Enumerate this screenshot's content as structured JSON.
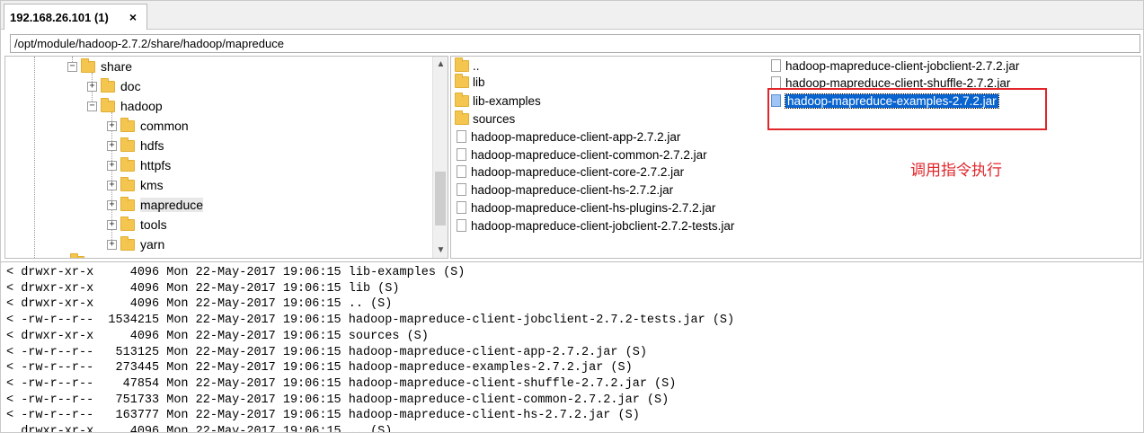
{
  "tab": {
    "title": "192.168.26.101 (1)",
    "close": "×"
  },
  "path": "/opt/module/hadoop-2.7.2/share/hadoop/mapreduce",
  "tree": [
    {
      "label": "share",
      "expander": "−"
    },
    {
      "label": "doc",
      "expander": "+"
    },
    {
      "label": "hadoop",
      "expander": "−"
    },
    {
      "label": "common",
      "expander": "+"
    },
    {
      "label": "hdfs",
      "expander": "+"
    },
    {
      "label": "httpfs",
      "expander": "+"
    },
    {
      "label": "kms",
      "expander": "+"
    },
    {
      "label": "mapreduce",
      "expander": "+"
    },
    {
      "label": "tools",
      "expander": "+"
    },
    {
      "label": "yarn",
      "expander": "+"
    }
  ],
  "files": {
    "left_column": [
      {
        "name": "..",
        "icon": "folder-icon"
      },
      {
        "name": "lib",
        "icon": "folder-icon"
      },
      {
        "name": "lib-examples",
        "icon": "folder-icon"
      },
      {
        "name": "sources",
        "icon": "folder-icon"
      },
      {
        "name": "hadoop-mapreduce-client-app-2.7.2.jar",
        "icon": "file-icon"
      },
      {
        "name": "hadoop-mapreduce-client-common-2.7.2.jar",
        "icon": "file-icon"
      },
      {
        "name": "hadoop-mapreduce-client-core-2.7.2.jar",
        "icon": "file-icon"
      },
      {
        "name": "hadoop-mapreduce-client-hs-2.7.2.jar",
        "icon": "file-icon"
      },
      {
        "name": "hadoop-mapreduce-client-hs-plugins-2.7.2.jar",
        "icon": "file-icon"
      },
      {
        "name": "hadoop-mapreduce-client-jobclient-2.7.2-tests.jar",
        "icon": "file-icon"
      }
    ],
    "right_column": [
      {
        "name": "hadoop-mapreduce-client-jobclient-2.7.2.jar",
        "icon": "file-icon"
      },
      {
        "name": "hadoop-mapreduce-client-shuffle-2.7.2.jar",
        "icon": "file-icon"
      },
      {
        "name": "hadoop-mapreduce-examples-2.7.2.jar",
        "icon": "file-icon",
        "selected": true
      }
    ]
  },
  "annotation": {
    "text": "调用指令执行",
    "color": "#e0262b"
  },
  "log": [
    "< drwxr-xr-x     4096 Mon 22-May-2017 19:06:15 lib-examples (S)",
    "< drwxr-xr-x     4096 Mon 22-May-2017 19:06:15 lib (S)",
    "< drwxr-xr-x     4096 Mon 22-May-2017 19:06:15 .. (S)",
    "< -rw-r--r--  1534215 Mon 22-May-2017 19:06:15 hadoop-mapreduce-client-jobclient-2.7.2-tests.jar (S)",
    "< drwxr-xr-x     4096 Mon 22-May-2017 19:06:15 sources (S)",
    "< -rw-r--r--   513125 Mon 22-May-2017 19:06:15 hadoop-mapreduce-client-app-2.7.2.jar (S)",
    "< -rw-r--r--   273445 Mon 22-May-2017 19:06:15 hadoop-mapreduce-examples-2.7.2.jar (S)",
    "< -rw-r--r--    47854 Mon 22-May-2017 19:06:15 hadoop-mapreduce-client-shuffle-2.7.2.jar (S)",
    "< -rw-r--r--   751733 Mon 22-May-2017 19:06:15 hadoop-mapreduce-client-common-2.7.2.jar (S)",
    "< -rw-r--r--   163777 Mon 22-May-2017 19:06:15 hadoop-mapreduce-client-hs-2.7.2.jar (S)",
    "  drwxr-xr-x     4096 Mon 22-May-2017 19:06:15 .. (S)"
  ],
  "colors": {
    "selection": "#0a64d0",
    "folder": "#f5c64f",
    "annotation": "#e0262b"
  }
}
